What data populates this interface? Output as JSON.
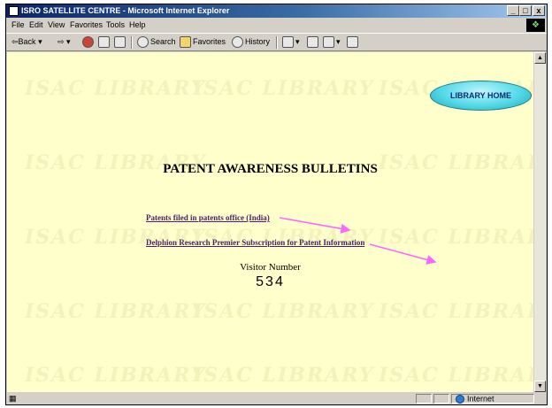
{
  "window": {
    "title": "ISRO SATELLITE CENTRE - Microsoft Internet Explorer",
    "controls": {
      "minimize": "_",
      "maximize": "□",
      "close": "x"
    }
  },
  "menu": [
    "File",
    "Edit",
    "View",
    "Favorites",
    "Tools",
    "Help"
  ],
  "toolbar": {
    "back": "⇦Back",
    "forward": "⇨",
    "search": "Search",
    "favorites": "Favorites",
    "history": "History"
  },
  "page": {
    "watermark_text": "ISAC LIBRARY",
    "library_home": "LIBRARY HOME",
    "heading": "PATENT AWARENESS BULLETINS",
    "links": [
      "Patents filed in patents office (India)",
      "Delphion Research Premier Subscription for Patent Information"
    ],
    "visitor_label": "Visitor Number",
    "visitor_count": "534",
    "arrow_color": "#ff66ff"
  },
  "status": {
    "zone": "Internet"
  }
}
